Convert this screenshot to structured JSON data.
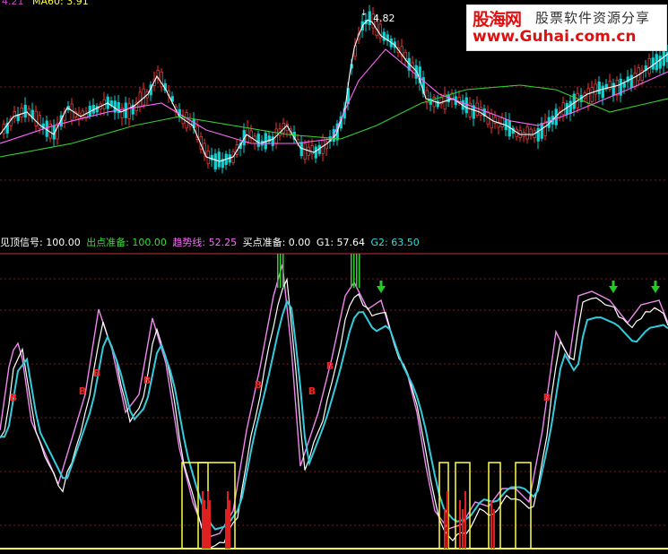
{
  "main_panel": {
    "readout": [
      {
        "text": "4.21",
        "color": "#cc44cc"
      },
      {
        "text": "MA60: 3.91",
        "color": "#ffff44"
      }
    ],
    "peak_label": "4.82",
    "colors": {
      "up": "#ff3030",
      "down": "#00d8d8",
      "ma_short": "#ffffff",
      "ma_mid": "#ff66ff",
      "ma_long": "#33cc33"
    }
  },
  "indicator_panel": {
    "readout": [
      {
        "text": "见顶信号: 100.00",
        "color": "#ffffff"
      },
      {
        "text": "出点准备: 100.00",
        "color": "#33dd33"
      },
      {
        "text": "趋势线: 52.25",
        "color": "#ff66ff"
      },
      {
        "text": "买点准备: 0.00",
        "color": "#ffffff"
      },
      {
        "text": "G1: 57.64",
        "color": "#ffffff"
      },
      {
        "text": "G2: 63.50",
        "color": "#33dddd"
      }
    ],
    "buy_marker": "B",
    "colors": {
      "k_line": "#ffffff",
      "trend": "#ee88ee",
      "g2": "#33ccdd",
      "prep": "#ffff44",
      "signal": "#dd2020",
      "top": "#33cc33",
      "arrow": "#22cc22"
    }
  },
  "watermark": {
    "logo": "股海网",
    "slogan": "股票软件资源分享",
    "url": "www.Guhai.com.cn"
  }
}
